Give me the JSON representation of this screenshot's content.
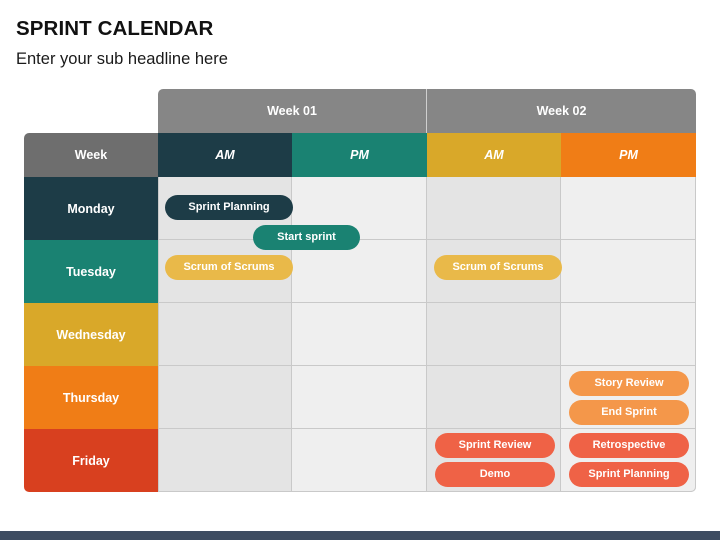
{
  "slide": {
    "title": "SPRINT CALENDAR",
    "subtitle": "Enter your sub headline here"
  },
  "table": {
    "corner_label": "Week",
    "weeks": [
      {
        "label": "Week 01"
      },
      {
        "label": "Week 02"
      }
    ],
    "columns": [
      {
        "label": "AM",
        "week": "Week 01",
        "color": "#1d3c47"
      },
      {
        "label": "PM",
        "week": "Week 01",
        "color": "#1a8272"
      },
      {
        "label": "AM",
        "week": "Week 02",
        "color": "#d9a829"
      },
      {
        "label": "PM",
        "week": "Week 02",
        "color": "#f07d16"
      }
    ],
    "days": [
      {
        "label": "Monday",
        "color": "#1d3c47"
      },
      {
        "label": "Tuesday",
        "color": "#1a8272"
      },
      {
        "label": "Wednesday",
        "color": "#d9a829"
      },
      {
        "label": "Thursday",
        "color": "#f07d16"
      },
      {
        "label": "Friday",
        "color": "#d8401f"
      }
    ],
    "events": [
      {
        "label": "Sprint Planning",
        "day": "Monday",
        "column": "Week 01 AM",
        "color": "#1d3c47"
      },
      {
        "label": "Start sprint",
        "day": "Monday",
        "column": "Week 01 AM/PM",
        "color": "#1a8272"
      },
      {
        "label": "Scrum of Scrums",
        "day": "Tuesday",
        "column": "Week 01 AM",
        "color": "#e9b949"
      },
      {
        "label": "Scrum of Scrums",
        "day": "Tuesday",
        "column": "Week 02 AM",
        "color": "#e9b949"
      },
      {
        "label": "Story Review",
        "day": "Thursday",
        "column": "Week 02 PM",
        "color": "#f4974a"
      },
      {
        "label": "End Sprint",
        "day": "Thursday",
        "column": "Week 02 PM",
        "color": "#f4974a"
      },
      {
        "label": "Sprint Review",
        "day": "Friday",
        "column": "Week 02 AM",
        "color": "#ef6246"
      },
      {
        "label": "Demo",
        "day": "Friday",
        "column": "Week 02 AM",
        "color": "#ef6246"
      },
      {
        "label": "Retrospective",
        "day": "Friday",
        "column": "Week 02 PM",
        "color": "#ef6246"
      },
      {
        "label": "Sprint Planning",
        "day": "Friday",
        "column": "Week 02 PM",
        "color": "#ef6246"
      }
    ]
  },
  "theme": {
    "banner_gray": "#868686",
    "corner_gray": "#6e6e6e",
    "cell_am": "#e4e4e4",
    "cell_pm": "#efefef",
    "grid_line": "#c9c9c9",
    "footer_bar": "#3e4c61"
  }
}
